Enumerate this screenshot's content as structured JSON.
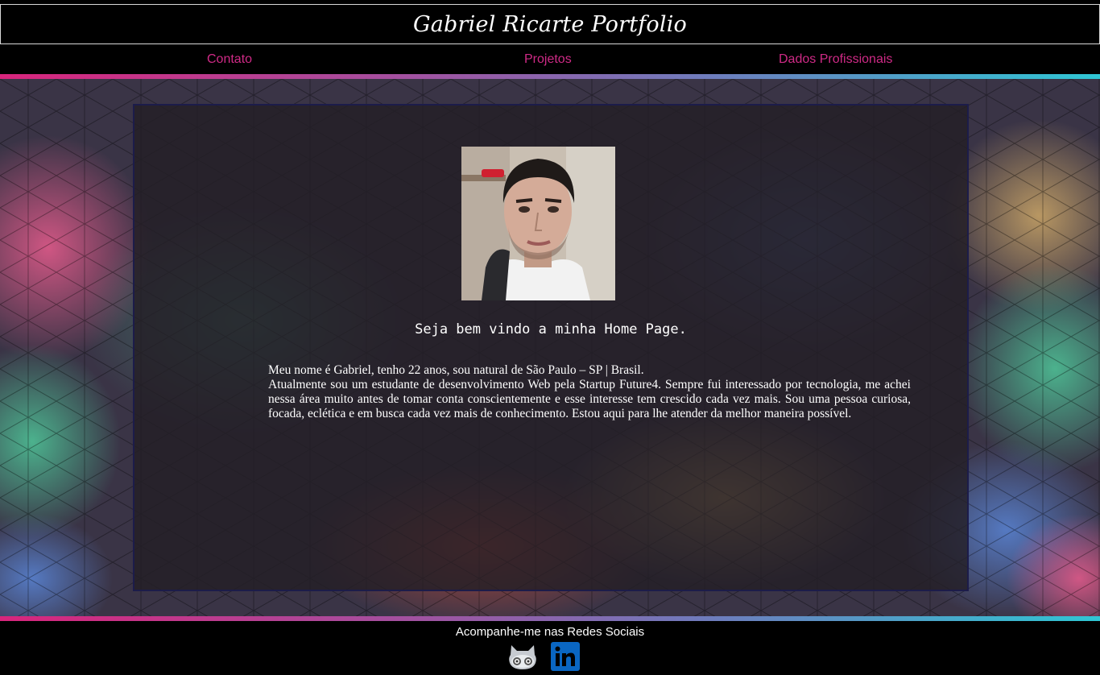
{
  "header": {
    "title": "Gabriel Ricarte Portfolio"
  },
  "nav": {
    "items": [
      {
        "label": "Contato"
      },
      {
        "label": "Projetos"
      },
      {
        "label": "Dados Profissionais"
      }
    ],
    "link_color": "#cf2a86"
  },
  "main": {
    "welcome": "Seja bem vindo a minha Home Page.",
    "bio_line1": "Meu nome é Gabriel, tenho 22 anos, sou natural de São Paulo – SP | Brasil.",
    "bio_paragraph": "Atualmente sou um estudante de desenvolvimento Web pela Startup Future4. Sempre fui interessado por tecnologia, me achei nessa área muito antes de tomar conta conscientemente e esse interesse tem crescido cada vez mais. Sou uma pessoa curiosa, focada, eclética e em busca cada vez mais de conhecimento. Estou aqui para lhe atender da melhor maneira possível."
  },
  "footer": {
    "social_title": "Acompanhe-me nas Redes Sociais",
    "icons": [
      "github-icon",
      "linkedin-icon"
    ]
  },
  "colors": {
    "gradient_start": "#d8257c",
    "gradient_end": "#2fc6d4",
    "linkedin": "#0a66c2"
  }
}
